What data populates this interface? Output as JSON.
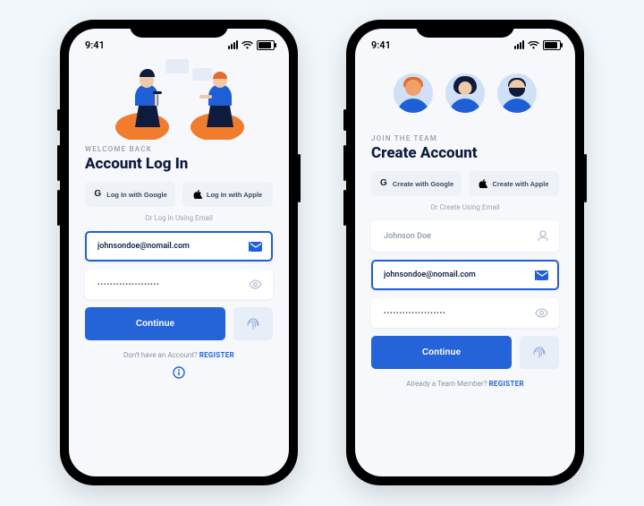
{
  "status": {
    "time": "9:41"
  },
  "login": {
    "eyebrow": "WELCOME BACK",
    "title": "Account Log In",
    "google_label": "Log In with Google",
    "apple_label": "Log In with Apple",
    "separator": "Or Log in Using Email",
    "email_value": "johnsondoe@nomail.com",
    "password_value": "••••••••••••••••••••",
    "cta": "Continue",
    "footer_text": "Don't have an Account? ",
    "footer_action": "REGISTER"
  },
  "signup": {
    "eyebrow": "JOIN THE TEAM",
    "title": "Create Account",
    "google_label": "Create with Google",
    "apple_label": "Create with Apple",
    "separator": "Or Create Using Email",
    "name_value": "Johnson Doe",
    "email_value": "johnsondoe@nomail.com",
    "password_value": "••••••••••••••••••••",
    "cta": "Continue",
    "footer_text": "Already a Team Member? ",
    "footer_action": "REGISTER"
  },
  "colors": {
    "accent": "#2563d9"
  }
}
